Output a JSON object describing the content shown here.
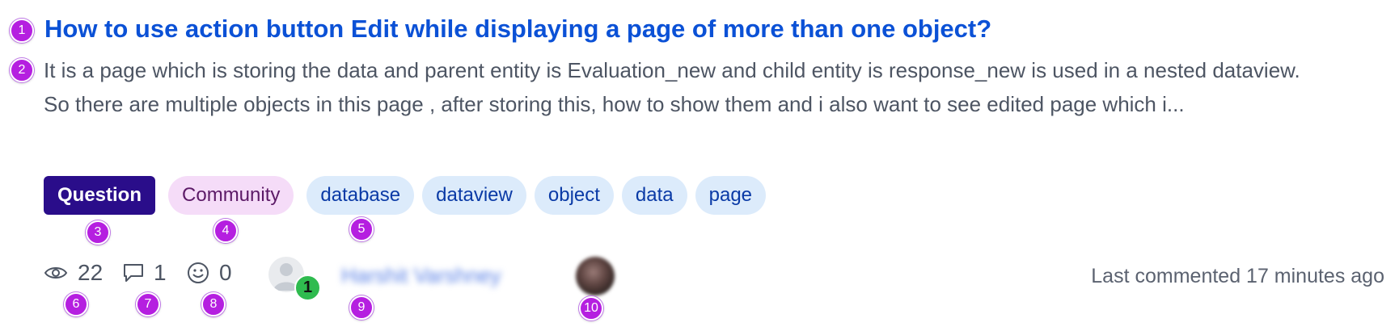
{
  "post": {
    "title": "How to use action button Edit while displaying a page of more than one object?",
    "description_lines": [
      "It is a page which is storing the data and parent entity is Evaluation_new and child entity is response_new  is used in a nested dataview.",
      "So there are multiple objects in this page , after storing this, how to show them  and i also want to see edited page which i..."
    ]
  },
  "tags": {
    "type": "Question",
    "category": "Community",
    "topics": [
      "database",
      "dataview",
      "object",
      "data",
      "page"
    ]
  },
  "stats": {
    "views": "22",
    "comments": "1",
    "reactions": "0"
  },
  "author": {
    "name": "Harshit Varshney",
    "badge": "1"
  },
  "last_activity": "Last commented 17 minutes ago",
  "markers": [
    "1",
    "2",
    "3",
    "4",
    "5",
    "6",
    "7",
    "8",
    "9",
    "10"
  ],
  "colors": {
    "title": "#0b51d6",
    "question_tag": "#2a0d8a",
    "community_tag": "#f5dcf8",
    "topic_tag": "#dcebfb",
    "marker": "#b51fe0",
    "badge": "#2fbb4f"
  },
  "icons": [
    "eye-icon",
    "comment-icon",
    "smiley-icon",
    "user-placeholder-icon"
  ]
}
